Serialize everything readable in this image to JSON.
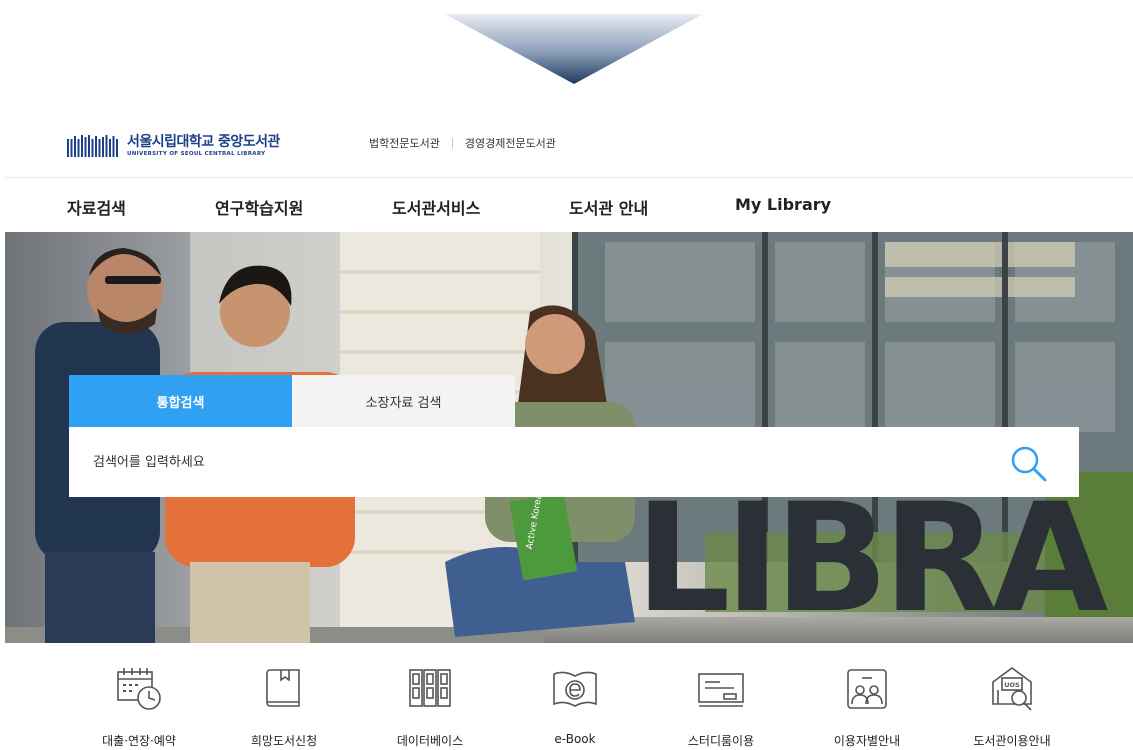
{
  "colors": {
    "brand_navy": "#1d3f8a",
    "tab_active": "#2fa0f2",
    "tab_inactive": "#f3f3f3",
    "search_icon": "#2fa0f2",
    "icon_line": "#555555"
  },
  "header": {
    "logo_ko": "서울시립대학교 중앙도서관",
    "logo_en": "UNIVERSITY OF SEOUL  CENTRAL LIBRARY",
    "sub_links": [
      "법학전문도서관",
      "경영경제전문도서관"
    ]
  },
  "nav": {
    "items": [
      "자료검색",
      "연구학습지원",
      "도서관서비스",
      "도서관 안내",
      "My Library"
    ]
  },
  "hero": {
    "sign_text": "LIBRA",
    "book_text": "Active Korean"
  },
  "search": {
    "tabs": [
      "통합검색",
      "소장자료 검색"
    ],
    "active_tab": "통합검색",
    "placeholder": "검색어를 입력하세요",
    "search_icon": "search-icon"
  },
  "quick_menu": [
    {
      "label": "대출·연장·예약",
      "icon": "calendar-clock-icon"
    },
    {
      "label": "희망도서신청",
      "icon": "book-icon"
    },
    {
      "label": "데이터베이스",
      "icon": "database-icon"
    },
    {
      "label": "e-Book",
      "icon": "ebook-icon"
    },
    {
      "label": "스터디룸이용",
      "icon": "study-room-icon"
    },
    {
      "label": "이용자별안내",
      "icon": "user-guide-icon"
    },
    {
      "label": "도서관이용안내",
      "icon": "library-guide-icon"
    }
  ],
  "quick_icon_texts": {
    "library_guide": "UOS"
  }
}
